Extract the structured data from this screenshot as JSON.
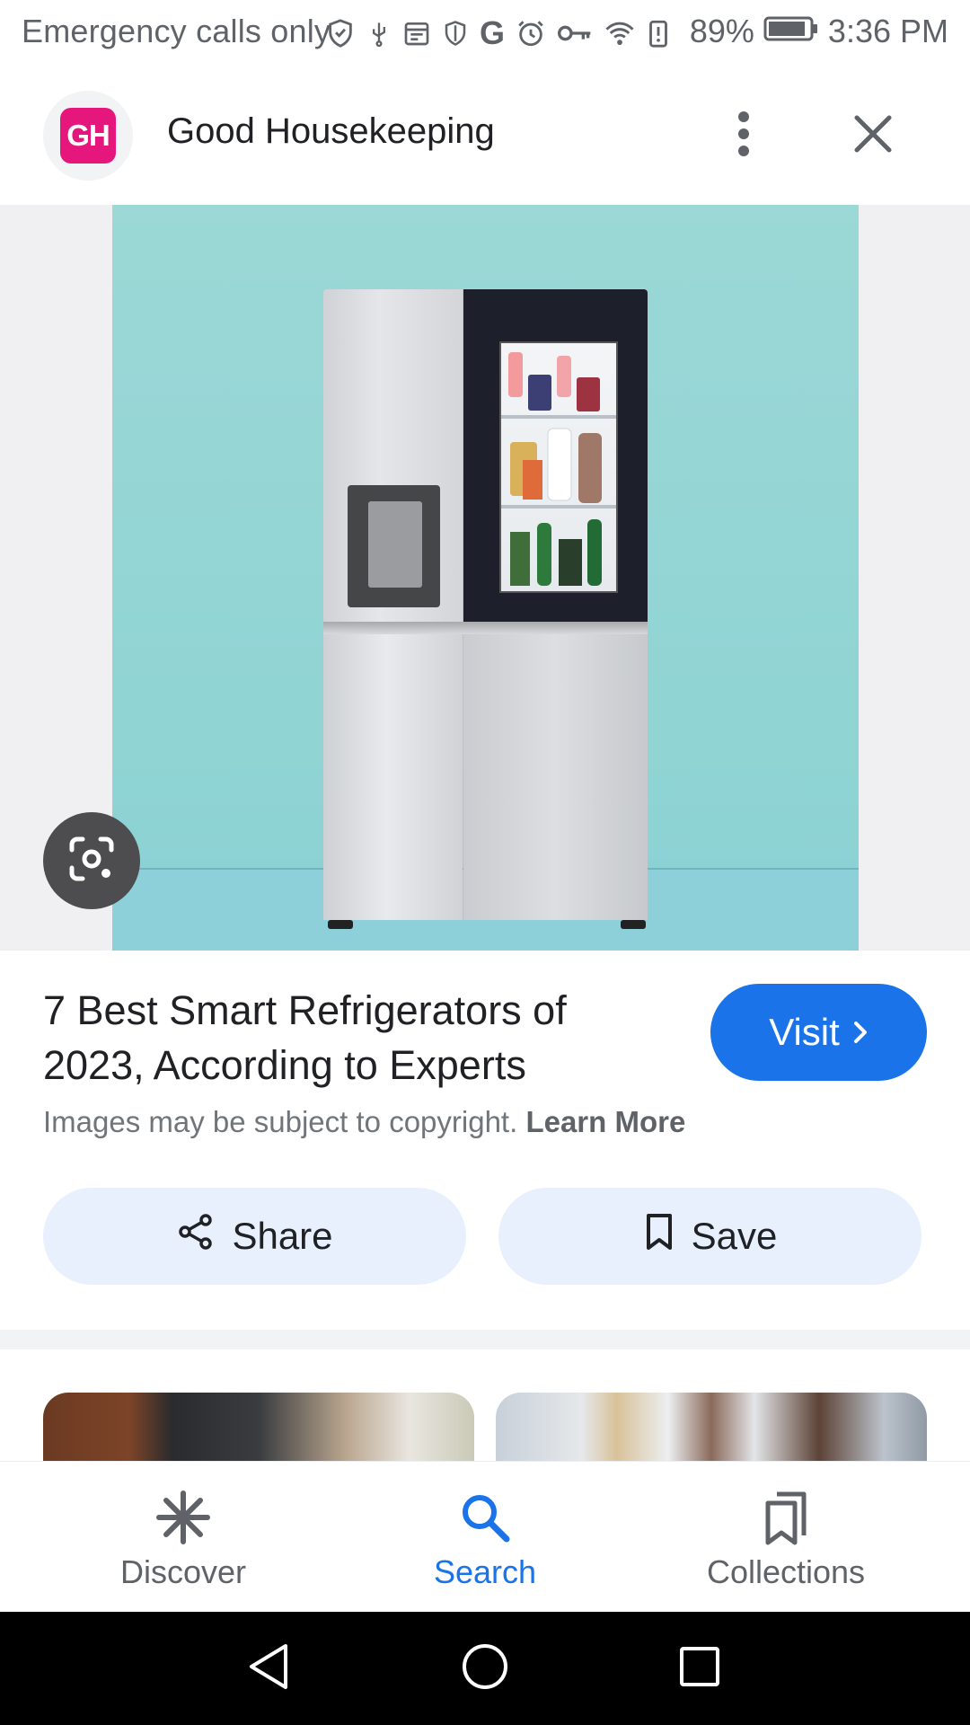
{
  "status_bar": {
    "carrier_text": "Emergency calls only",
    "battery_percent": "89%",
    "time": "3:36 PM",
    "icons": [
      "vpn-shield-icon",
      "usb-icon",
      "calendar-icon",
      "shield-icon",
      "google-icon",
      "alarm-icon",
      "key-icon",
      "wifi-icon",
      "battery-alert-icon",
      "battery-icon"
    ]
  },
  "header": {
    "logo_text": "GH",
    "site_name": "Good Housekeeping",
    "more_icon": "more-vert-icon",
    "close_icon": "close-icon"
  },
  "colors": {
    "brand_logo": "#e6177c",
    "accent": "#1a73e8",
    "action_button_bg": "#e8f0fe"
  },
  "result": {
    "title": "7 Best Smart Refrigerators of 2023, According to Experts",
    "visit_label": "Visit",
    "copyright_text": "Images may be subject to copyright.",
    "learn_more": "Learn More",
    "share_label": "Share",
    "save_label": "Save"
  },
  "bottom_nav": {
    "items": [
      {
        "label": "Discover",
        "icon": "asterisk-icon",
        "active": false
      },
      {
        "label": "Search",
        "icon": "search-icon",
        "active": true
      },
      {
        "label": "Collections",
        "icon": "bookmarks-icon",
        "active": false
      }
    ]
  }
}
